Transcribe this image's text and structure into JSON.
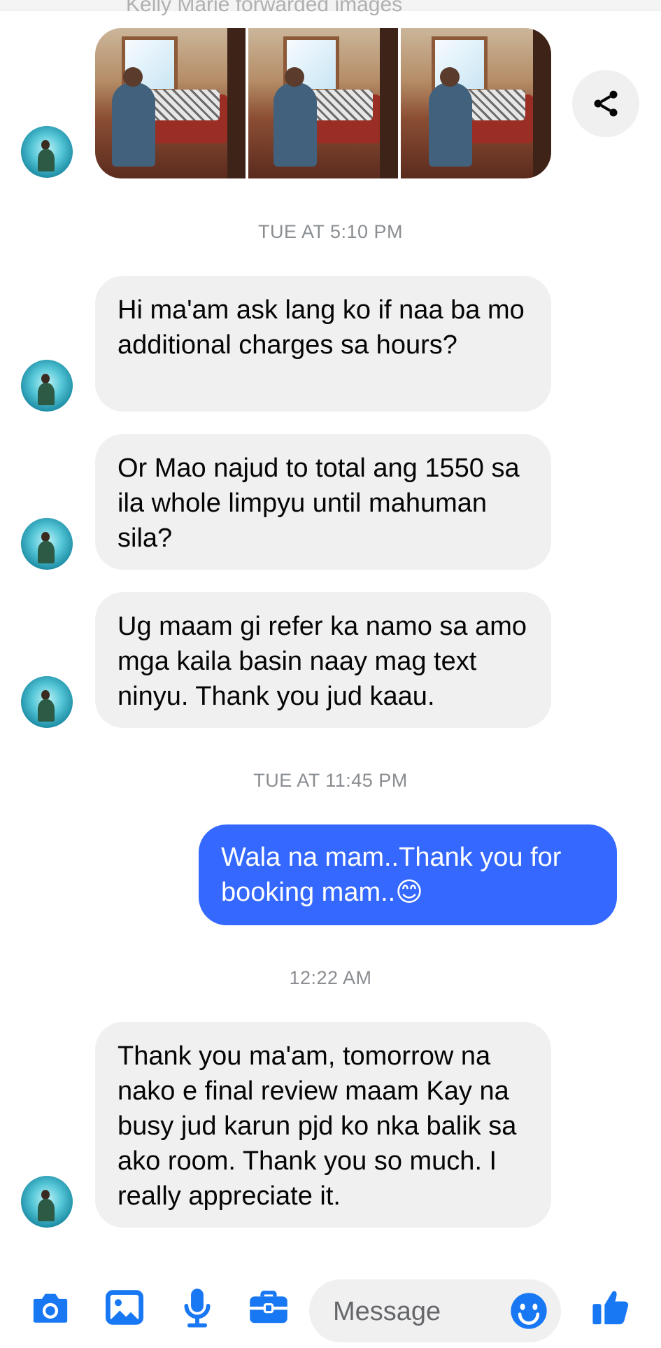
{
  "top_cutoff": {
    "text": "Kelly Marie forwarded images"
  },
  "timestamps": {
    "t1": "TUE AT 5:10 PM",
    "t2": "TUE AT 11:45 PM",
    "t3": "12:22 AM"
  },
  "messages": [
    {
      "direction": "incoming",
      "text": "Hi ma'am ask lang ko if naa ba mo additional charges sa hours?"
    },
    {
      "direction": "incoming",
      "text": "Or Mao najud to total ang 1550 sa ila whole limpyu until mahuman sila?"
    },
    {
      "direction": "incoming",
      "text": "Ug maam gi refer ka namo sa amo mga kaila basin naay mag text ninyu. Thank you jud kaau."
    },
    {
      "direction": "outgoing",
      "text": "Wala na mam..Thank you for booking mam..😊"
    },
    {
      "direction": "incoming",
      "text": "Thank you ma'am, tomorrow na nako e final review maam Kay na busy jud karun pjd ko nka balik sa ako room. Thank you so much. I really appreciate it."
    }
  ],
  "composer": {
    "placeholder": "Message",
    "icons": [
      "camera-icon",
      "gallery-icon",
      "microphone-icon",
      "briefcase-icon",
      "emoji-icon",
      "thumbs-up-icon"
    ]
  },
  "colors": {
    "accent": "#1877f2",
    "outgoing_bubble": "#3468ff",
    "incoming_bubble": "#f0f0f0",
    "timestamp": "#8a8d91"
  }
}
